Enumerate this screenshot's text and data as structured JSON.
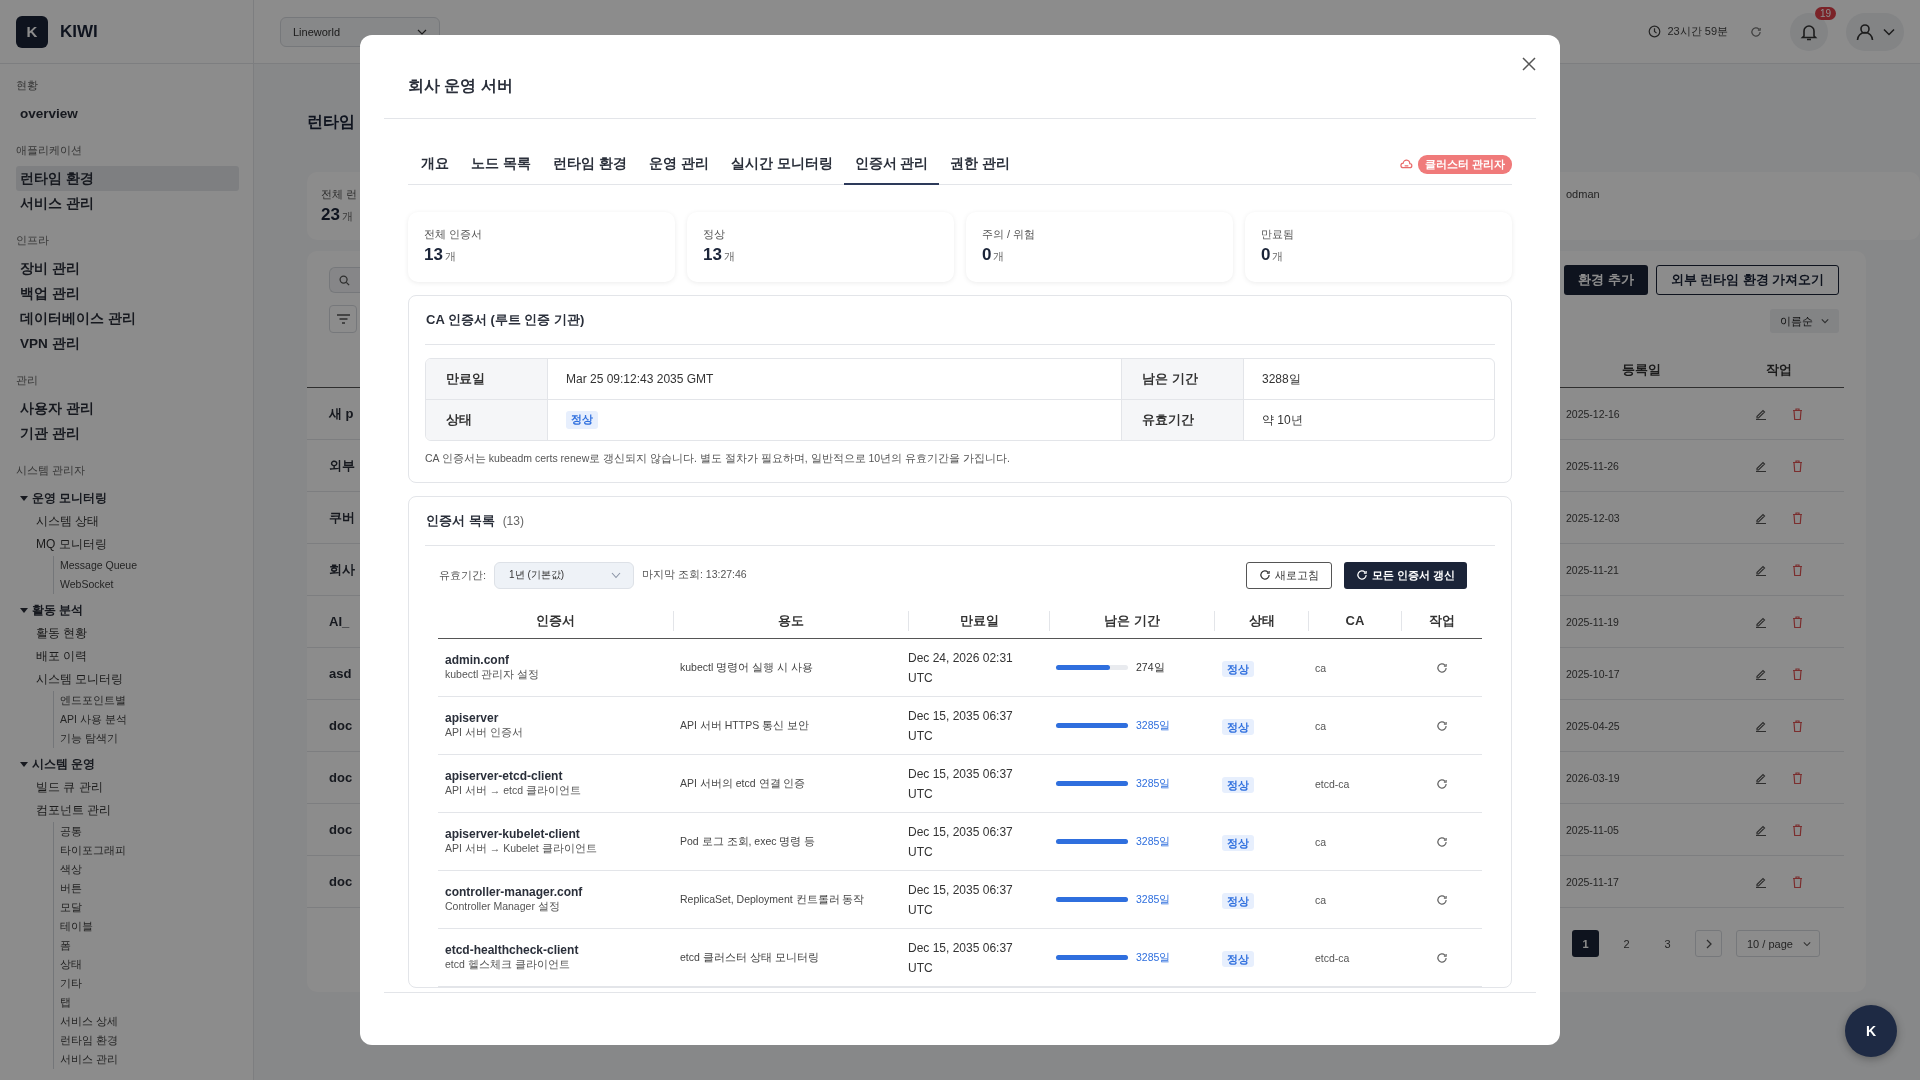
{
  "app": {
    "logo_letter": "K",
    "name": "KIWI"
  },
  "header": {
    "workspace": "Lineworld",
    "session_time": "23시간 59분",
    "notifications": "19"
  },
  "sidebar": {
    "sections": [
      {
        "title": "현황",
        "items": [
          {
            "label": "overview",
            "selected": false
          }
        ]
      },
      {
        "title": "애플리케이션",
        "items": [
          {
            "label": "런타임 환경",
            "selected": true
          },
          {
            "label": "서비스 관리",
            "selected": false
          }
        ]
      },
      {
        "title": "인프라",
        "items": [
          {
            "label": "장비 관리",
            "selected": false
          },
          {
            "label": "백업 관리",
            "selected": false
          },
          {
            "label": "데이터베이스 관리",
            "selected": false
          },
          {
            "label": "VPN 관리",
            "selected": false
          }
        ]
      },
      {
        "title": "관리",
        "items": [
          {
            "label": "사용자 관리",
            "selected": false
          },
          {
            "label": "기관 관리",
            "selected": false
          }
        ]
      }
    ],
    "admin_title": "시스템 관리자",
    "admin_tree": [
      {
        "label": "운영 모니터링",
        "expanded": true,
        "children": [
          {
            "label": "시스템 상태"
          },
          {
            "label": "MQ 모니터링",
            "children": [
              {
                "label": "Message Queue"
              },
              {
                "label": "WebSocket"
              }
            ]
          }
        ]
      },
      {
        "label": "활동 분석",
        "expanded": true,
        "children": [
          {
            "label": "활동 현황"
          },
          {
            "label": "배포 이력"
          },
          {
            "label": "시스템 모니터링",
            "children": [
              {
                "label": "엔드포인트별"
              },
              {
                "label": "API 사용 분석"
              },
              {
                "label": "기능 탐색기"
              }
            ]
          }
        ]
      },
      {
        "label": "시스템 운영",
        "expanded": true,
        "children": [
          {
            "label": "빌드 큐 관리"
          },
          {
            "label": "컴포넌트 관리",
            "children": [
              {
                "label": "공통"
              },
              {
                "label": "타이포그래피"
              },
              {
                "label": "색상"
              },
              {
                "label": "버튼"
              },
              {
                "label": "모달"
              },
              {
                "label": "테이블"
              },
              {
                "label": "폼"
              },
              {
                "label": "상태"
              },
              {
                "label": "기타"
              },
              {
                "label": "탭"
              },
              {
                "label": "서비스 상세"
              },
              {
                "label": "런타임 환경"
              },
              {
                "label": "서비스 관리"
              }
            ]
          }
        ]
      }
    ]
  },
  "page": {
    "title": "런타임",
    "stat_label": "전체 런",
    "stat_value": "23",
    "stat_unit": "개",
    "stat_right": "odman",
    "add_button": "환경 추가",
    "import_button": "외부 런타임 환경 가져오기",
    "sort": "이름순",
    "columns": [
      "등록일",
      "작업"
    ],
    "rows": [
      {
        "name": "새 p",
        "date": "2025-12-16"
      },
      {
        "name": "외부",
        "date": "2025-11-26"
      },
      {
        "name": "쿠버",
        "date": "2025-12-03"
      },
      {
        "name": "회사",
        "date": "2025-11-21"
      },
      {
        "name": "AI_",
        "date": "2025-11-19"
      },
      {
        "name": "asd",
        "date": "2025-10-17"
      },
      {
        "name": "doc",
        "date": "2025-04-25"
      },
      {
        "name": "doc",
        "date": "2026-03-19"
      },
      {
        "name": "doc",
        "date": "2025-11-05"
      },
      {
        "name": "doc",
        "date": "2025-11-17"
      }
    ],
    "pages": [
      {
        "label": "1",
        "selected": true
      },
      {
        "label": "2",
        "selected": false
      },
      {
        "label": "3",
        "selected": false
      }
    ],
    "page_size": "10 / page"
  },
  "fab": "K",
  "modal": {
    "title": "회사 운영 서버",
    "tabs": [
      {
        "label": "개요",
        "selected": false
      },
      {
        "label": "노드 목록",
        "selected": false
      },
      {
        "label": "런타임 환경",
        "selected": false
      },
      {
        "label": "운영 관리",
        "selected": false
      },
      {
        "label": "실시간 모니터링",
        "selected": false
      },
      {
        "label": "인증서 관리",
        "selected": true
      },
      {
        "label": "권한 관리",
        "selected": false
      }
    ],
    "role_badge": "클러스터 관리자",
    "stats": [
      {
        "label": "전체 인증서",
        "value": "13",
        "unit": "개"
      },
      {
        "label": "정상",
        "value": "13",
        "unit": "개"
      },
      {
        "label": "주의 / 위험",
        "value": "0",
        "unit": "개"
      },
      {
        "label": "만료됨",
        "value": "0",
        "unit": "개"
      }
    ],
    "ca_certificate": {
      "title": "CA 인증서 (루트 인증 기관)",
      "expiry_label": "만료일",
      "expiry": "Mar 25 09:12:43 2035 GMT",
      "remaining_label": "남은 기간",
      "remaining": "3288일",
      "status_label": "상태",
      "status": "정상",
      "validity_label": "유효기간",
      "validity": "약 10년",
      "note": "CA 인증서는 kubeadm certs renew로 갱신되지 않습니다. 별도 절차가 필요하며, 일반적으로 10년의 유효기간을 가집니다."
    },
    "certificate_list": {
      "title": "인증서 목록",
      "count": "(13)",
      "validity_label": "유효기간:",
      "validity_select": "1년 (기본값)",
      "last_checked": "마지막 조회: 13:27:46",
      "refresh_button": "새로고침",
      "renew_all_button": "모든 인증서 갱신",
      "columns": [
        "인증서",
        "용도",
        "만료일",
        "남은 기간",
        "상태",
        "CA",
        "작업"
      ],
      "rows": [
        {
          "name": "admin.conf",
          "description": "kubectl 관리자 설정",
          "usage": "kubectl 명령어 실행 시 사용",
          "expiry": "Dec 24, 2026 02:31",
          "expiry_zone": "UTC",
          "level": 0.75,
          "remaining": "274일",
          "status": "정상",
          "ca": "ca"
        },
        {
          "name": "apiserver",
          "description": "API 서버 인증서",
          "usage": "API 서버 HTTPS 통신 보안",
          "expiry": "Dec 15, 2035 06:37",
          "expiry_zone": "UTC",
          "level": 1,
          "remaining": "3285일",
          "status": "정상",
          "ca": "ca"
        },
        {
          "name": "apiserver-etcd-client",
          "description": "API 서버 → etcd 클라이언트",
          "usage": "API 서버의 etcd 연결 인증",
          "expiry": "Dec 15, 2035 06:37",
          "expiry_zone": "UTC",
          "level": 1,
          "remaining": "3285일",
          "status": "정상",
          "ca": "etcd-ca"
        },
        {
          "name": "apiserver-kubelet-client",
          "description": "API 서버 → Kubelet 클라이언트",
          "usage": "Pod 로그 조회, exec 명령 등",
          "expiry": "Dec 15, 2035 06:37",
          "expiry_zone": "UTC",
          "level": 1,
          "remaining": "3285일",
          "status": "정상",
          "ca": "ca"
        },
        {
          "name": "controller-manager.conf",
          "description": "Controller Manager 설정",
          "usage": "ReplicaSet, Deployment 컨트롤러 동작",
          "expiry": "Dec 15, 2035 06:37",
          "expiry_zone": "UTC",
          "level": 1,
          "remaining": "3285일",
          "status": "정상",
          "ca": "ca"
        },
        {
          "name": "etcd-healthcheck-client",
          "description": "etcd 헬스체크 클라이언트",
          "usage": "etcd 클러스터 상태 모니터링",
          "expiry": "Dec 15, 2035 06:37",
          "expiry_zone": "UTC",
          "level": 1,
          "remaining": "3285일",
          "status": "정상",
          "ca": "etcd-ca"
        }
      ]
    }
  }
}
